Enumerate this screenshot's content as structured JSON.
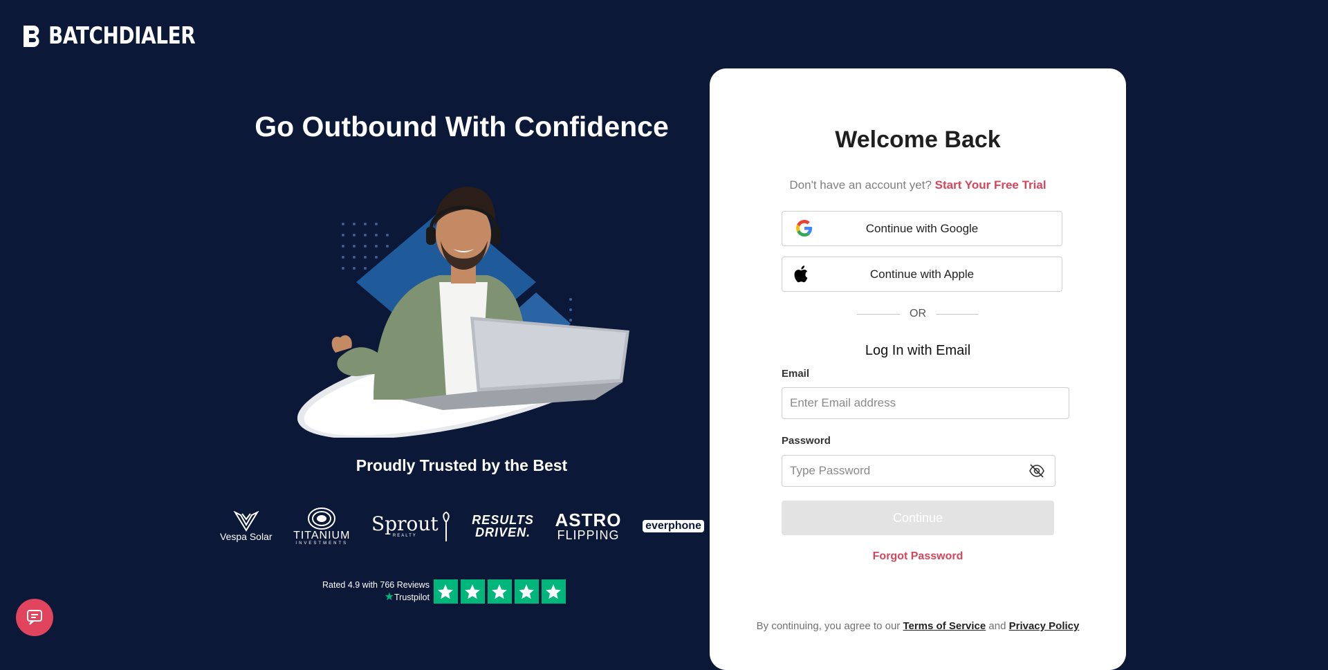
{
  "brand": {
    "name": "BATCHDIALER"
  },
  "hero": {
    "headline": "Go Outbound With Confidence",
    "trusted_title": "Proudly Trusted by the Best"
  },
  "partners": [
    {
      "name": "Vespa Solar",
      "icon": "vespa-solar-logo"
    },
    {
      "name": "TITANIUM",
      "sub": "INVESTMENTS",
      "icon": "titanium-logo"
    },
    {
      "name": "Sprout",
      "sub": "REALTY",
      "icon": "sprout-realty-logo"
    },
    {
      "name": "RESULTS",
      "sub": "DRIVEN.",
      "icon": "results-driven-logo"
    },
    {
      "name": "ASTRO",
      "sub": "FLIPPING",
      "icon": "astro-flipping-logo"
    },
    {
      "name": "everphone",
      "icon": "everphone-logo"
    }
  ],
  "trustpilot": {
    "rating_text": "Rated 4.9 with 766 Reviews",
    "brand": "Trustpilot",
    "stars": 5
  },
  "login": {
    "title": "Welcome Back",
    "no_account_text": "Don't have an account yet?",
    "free_trial_link": "Start Your Free Trial",
    "google_button": "Continue with Google",
    "apple_button": "Continue with Apple",
    "or_text": "OR",
    "email_section_title": "Log In with Email",
    "email_label": "Email",
    "email_placeholder": "Enter Email address",
    "password_label": "Password",
    "password_placeholder": "Type Password",
    "continue_button": "Continue",
    "forgot_password": "Forgot Password",
    "terms_prefix": "By continuing, you agree to our",
    "terms_link": "Terms of Service",
    "terms_and": "and",
    "privacy_link": "Privacy Policy"
  },
  "colors": {
    "background": "#0c1838",
    "accent": "#d8455a",
    "trustpilot_green": "#00b67a",
    "chat_button": "#e0455d"
  },
  "icons": {
    "chat": "chat-support-icon",
    "eye": "eye-off-icon",
    "google": "google-icon",
    "apple": "apple-icon"
  }
}
